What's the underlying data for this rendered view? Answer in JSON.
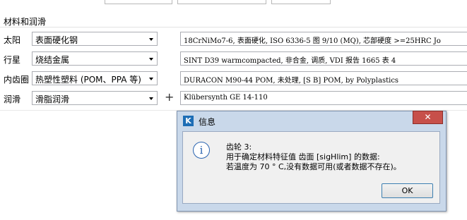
{
  "section": {
    "title": "材料和润滑"
  },
  "rows": [
    {
      "label": "太阳",
      "material_type": "表面硬化钢",
      "material_spec": "18CrNiMo7-6, 表面硬化, ISO 6336-5 图 9/10 (MQ), 芯部硬度 >=25HRC Jo"
    },
    {
      "label": "行星",
      "material_type": "烧结金属",
      "material_spec": "SINT D39 warmcompacted, 非合金, 调质, VDI 报告 1665 表 4"
    },
    {
      "label": "内齿圈",
      "material_type": "热塑性塑料 (POM、PPA 等)",
      "material_spec": "DURACON M90-44 POM, 未处理, [S B] POM, by Polyplastics"
    },
    {
      "label": "润滑",
      "material_type": "滑脂润滑",
      "material_spec": "Klübersynth GE 14-110"
    }
  ],
  "add_button": {
    "symbol": "+"
  },
  "dialog": {
    "app_icon": "K",
    "title": "信息",
    "close_symbol": "✕",
    "info_symbol": "i",
    "message_lines": [
      "齿轮 3:",
      "用于确定材料特征值 齿面 [sigHlim] 的数据:",
      "若温度为 70 ° C,没有数据可用(或者数据不存在)。"
    ],
    "ok_label": "OK"
  },
  "icons": {
    "combo_arrow": "chevron-down-icon",
    "info": "info-icon",
    "close": "close-icon"
  },
  "colors": {
    "dialog_frame": "#c9d8ea",
    "close_button": "#c7504a",
    "app_icon_bg": "#1d6db5",
    "info_icon": "#2a64b0"
  }
}
